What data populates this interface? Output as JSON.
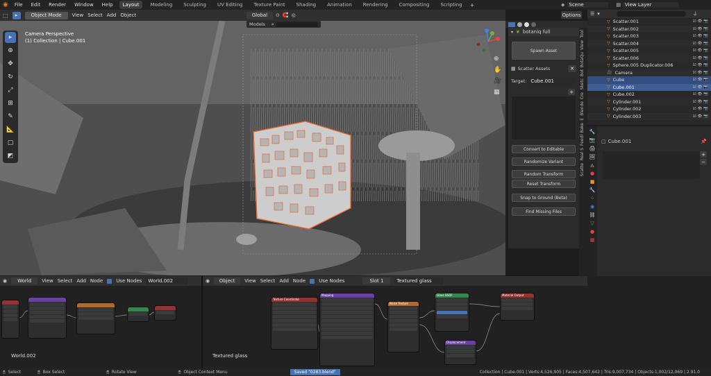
{
  "topbar": {
    "menus": [
      "File",
      "Edit",
      "Render",
      "Window",
      "Help"
    ],
    "workspaces": [
      "Layout",
      "Modeling",
      "Sculpting",
      "UV Editing",
      "Texture Paint",
      "Shading",
      "Animation",
      "Rendering",
      "Compositing",
      "Scripting"
    ],
    "active_workspace": "Layout",
    "scene": "Scene",
    "view_layer": "View Layer"
  },
  "viewport_header": {
    "mode": "Object Mode",
    "menus": [
      "View",
      "Select",
      "Add",
      "Object"
    ],
    "orientation": "Global",
    "options": "Options",
    "models_dropdown": "Models"
  },
  "viewport": {
    "camera_label": "Camera Perspective",
    "collection_label": "(1) Collection | Cube.001",
    "axes": [
      "X",
      "Y",
      "Z"
    ]
  },
  "npanel": {
    "addon_title": "botaniq full",
    "spawn_asset": "Spawn Asset",
    "scatter_assets": "Scatter Assets",
    "target_label": "Target:",
    "target_value": "Cube.001",
    "buttons": [
      "Convert to Editable",
      "Randomize Variant",
      "Random Transform",
      "Reset Transform",
      "Snap to Ground (Beta)",
      "Find Missing Files"
    ],
    "tabs": [
      "Tool",
      "View",
      "BotaQu",
      "Bot",
      "Sketc",
      "Cre",
      "Blende",
      "E",
      "Bake",
      "Feedl",
      "Real S",
      "Scatte",
      "Edit"
    ]
  },
  "outliner": {
    "rows": [
      {
        "name": "Scatter.001",
        "state": ""
      },
      {
        "name": "Scatter.002",
        "state": ""
      },
      {
        "name": "Scatter.003",
        "state": ""
      },
      {
        "name": "Scatter.004",
        "state": ""
      },
      {
        "name": "Scatter.005",
        "state": ""
      },
      {
        "name": "Scatter.006",
        "state": ""
      },
      {
        "name": "Sphere.005 Duplicator.006",
        "state": ""
      },
      {
        "name": "Camera",
        "state": ""
      },
      {
        "name": "Cube",
        "state": "sel"
      },
      {
        "name": "Cube.001",
        "state": "act"
      },
      {
        "name": "Cube.002",
        "state": ""
      },
      {
        "name": "Cylinder.001",
        "state": ""
      },
      {
        "name": "Cylinder.002",
        "state": ""
      },
      {
        "name": "Cylinder.003",
        "state": ""
      }
    ]
  },
  "properties": {
    "object_name": "Cube.001"
  },
  "node_editor_left": {
    "type": "World",
    "menus": [
      "View",
      "Select",
      "Add",
      "Node"
    ],
    "use_nodes": "Use Nodes",
    "datablock": "World.002",
    "label": "World.002"
  },
  "node_editor_right": {
    "type": "Object",
    "menus": [
      "View",
      "Select",
      "Add",
      "Node"
    ],
    "use_nodes": "Use Nodes",
    "slot": "Slot 1",
    "material": "Textured glass",
    "label": "Textured glass",
    "nodes": [
      {
        "title": "Texture Coordinate",
        "color": "#9a2f2f"
      },
      {
        "title": "Mapping",
        "color": "#6a3fa6"
      },
      {
        "title": "Noise Texture",
        "color": "#b26a2b"
      },
      {
        "title": "Glass BSDF",
        "color": "#2f8a4a"
      },
      {
        "title": "Material Output",
        "color": "#9a2f2f"
      },
      {
        "title": "Displacement",
        "color": "#6a3fa6"
      }
    ]
  },
  "statusbar": {
    "select": "Select",
    "box_select": "Box Select",
    "rotate_view": "Rotate View",
    "context_menu": "Object Context Menu",
    "saved": "Saved \"0283.blend\"",
    "stats": "Collection | Cube.001 | Verts:4,526,905 | Faces:4,507,642 | Tris:9,007,734 | Objects:1,002/12,069 | 2.91.0"
  },
  "colors": {
    "accent": "#4772b3",
    "selection_outline": "#e8672f",
    "header": "#303030"
  }
}
